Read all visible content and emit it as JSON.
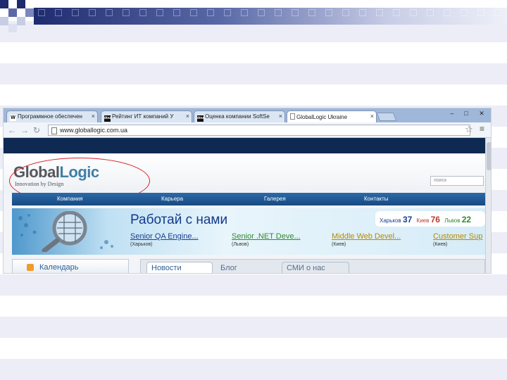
{
  "slide": {
    "colors": {
      "dark": "#1f2b6f",
      "mid": "#5a6aa8",
      "light": "#c8cde6",
      "stripe": "#ecedf6"
    }
  },
  "browser": {
    "tabs": [
      {
        "icon": "wikipedia-icon",
        "icon_text": "W",
        "label": "Программное обеспечен"
      },
      {
        "icon": "dou-icon",
        "icon_text": "dou",
        "label": "Рейтинг ИТ компаний У"
      },
      {
        "icon": "dou-icon",
        "icon_text": "dou",
        "label": "Оценка компании SoftSe"
      },
      {
        "icon": "page-icon",
        "icon_text": "",
        "label": "GlobalLogic Ukraine"
      }
    ],
    "address": "www.globallogic.com.ua",
    "window_buttons": [
      "–",
      "□",
      "✕"
    ]
  },
  "site": {
    "logo": {
      "part1": "Global",
      "part2": "Logic",
      "tagline": "Innovation by Design"
    },
    "search_placeholder": "поиск",
    "menu": [
      "Компания",
      "Карьера",
      "Галерея",
      "Контакты"
    ],
    "banner": {
      "title": "Работай с нами",
      "counters": [
        {
          "city": "Харьков",
          "count": "37",
          "color": "#1a3f8f"
        },
        {
          "city": "Киев",
          "count": "76",
          "color": "#c0392b"
        },
        {
          "city": "Львов",
          "count": "22",
          "color": "#2f8a2f"
        }
      ],
      "jobs": [
        {
          "title": "Senior QA Engine...",
          "city": "(Харьков)",
          "color": "#1a3f8f"
        },
        {
          "title": "Senior .NET Deve...",
          "city": "(Львов)",
          "color": "#2f8a2f"
        },
        {
          "title": "Middle Web Devel...",
          "city": "(Киев)",
          "color": "#b58a00"
        },
        {
          "title": "Customer Sup",
          "city": "(Киев)",
          "color": "#b58a00"
        }
      ]
    },
    "left_panel_label": "Календарь",
    "content_tabs": [
      "Новости",
      "Блог",
      "СМИ о нас"
    ]
  }
}
